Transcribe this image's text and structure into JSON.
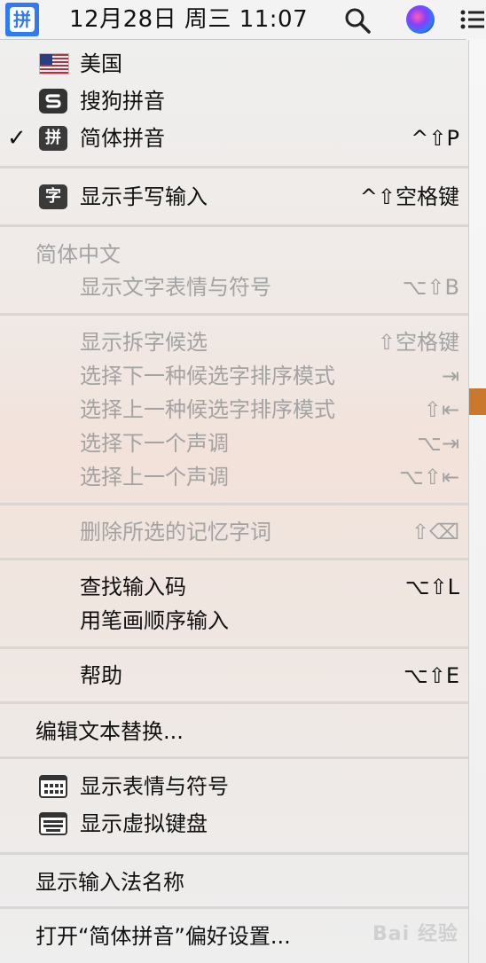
{
  "menubar": {
    "ime_glyph": "拼",
    "datetime": "12月28日 周三  11:07",
    "icons": [
      "input-source-icon",
      "search-icon",
      "siri-icon",
      "notification-list-icon"
    ]
  },
  "menu": {
    "sources": [
      {
        "label": "美国",
        "icon": "us-flag-icon"
      },
      {
        "label": "搜狗拼音",
        "icon": "sogou-icon"
      },
      {
        "label": "简体拼音",
        "icon": "pinyin-icon",
        "icon_glyph": "拼",
        "checked": "✓",
        "shortcut": "^⇧P"
      }
    ],
    "handwriting": {
      "label": "显示手写输入",
      "icon_glyph": "字",
      "shortcut": "^⇧空格键"
    },
    "section_header": "简体中文",
    "emoji_symbols": {
      "label": "显示文字表情与符号",
      "shortcut": "⌥⇧B"
    },
    "candidates": [
      {
        "label": "显示拆字候选",
        "shortcut": "⇧空格键"
      },
      {
        "label": "选择下一种候选字排序模式",
        "shortcut": "⇥"
      },
      {
        "label": "选择上一种候选字排序模式",
        "shortcut": "⇧⇤"
      },
      {
        "label": "选择下一个声调",
        "shortcut": "⌥⇥"
      },
      {
        "label": "选择上一个声调",
        "shortcut": "⌥⇧⇤"
      }
    ],
    "delete_memory": {
      "label": "删除所选的记忆字词",
      "shortcut": "⇧⌫"
    },
    "lookup": {
      "label": "查找输入码",
      "shortcut": "⌥⇧L"
    },
    "stroke_input": {
      "label": "用笔画顺序输入"
    },
    "help": {
      "label": "帮助",
      "shortcut": "⌥⇧E"
    },
    "edit_replacements": {
      "label": "编辑文本替换..."
    },
    "show_emoji": {
      "label": "显示表情与符号"
    },
    "show_keyboard": {
      "label": "显示虚拟键盘"
    },
    "show_ime_name": {
      "label": "显示输入法名称"
    },
    "open_prefs": {
      "label": "打开“简体拼音”偏好设置..."
    }
  },
  "watermark": "Bai 经验",
  "colors": {
    "ime_blue": "#2f7bf5",
    "disabled_text": "#a3a3a3"
  }
}
